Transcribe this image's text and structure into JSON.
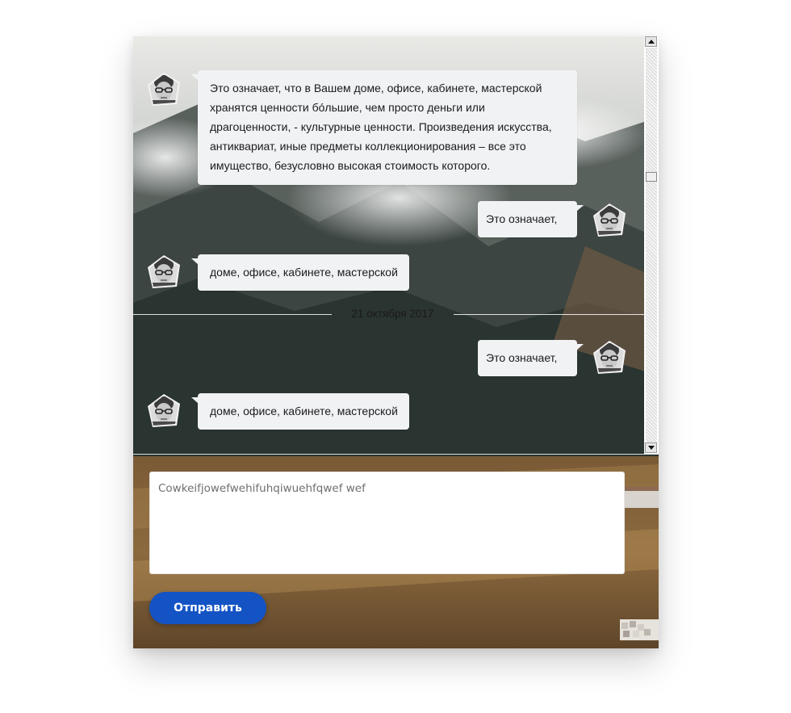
{
  "chat": {
    "messages": [
      {
        "side": "left",
        "text_lines": [
          "Это означает, что в Вашем доме, офисе, кабинете, мастерской",
          "хранятся ценности бо́льшие, чем просто деньги или",
          "драгоценности, - культурные ценности. Произведения искусства,",
          "антиквариат, иные предметы коллекционирования – все это",
          "имущество, безусловно высокая стоимость которого."
        ]
      },
      {
        "side": "right",
        "text": "Это означает,"
      },
      {
        "side": "left",
        "text": "доме, офисе, кабинете, мастерской"
      },
      {
        "side": "right",
        "text": "Это означает,"
      },
      {
        "side": "left",
        "text": "доме, офисе, кабинете, мастерской"
      }
    ],
    "date_separator": "21 октября 2017"
  },
  "compose": {
    "value": "Cowkeifjowefwehifuhqiwuehfqwef wef"
  },
  "send_button": {
    "label": "Отправить"
  },
  "icons": {
    "avatar": "user-avatar-icon",
    "scroll_up": "triangle-up-icon",
    "scroll_down": "triangle-down-icon"
  },
  "colors": {
    "accent": "#1353c4",
    "bubble": "#f1f2f4",
    "compose_bg": "#ffffff"
  }
}
